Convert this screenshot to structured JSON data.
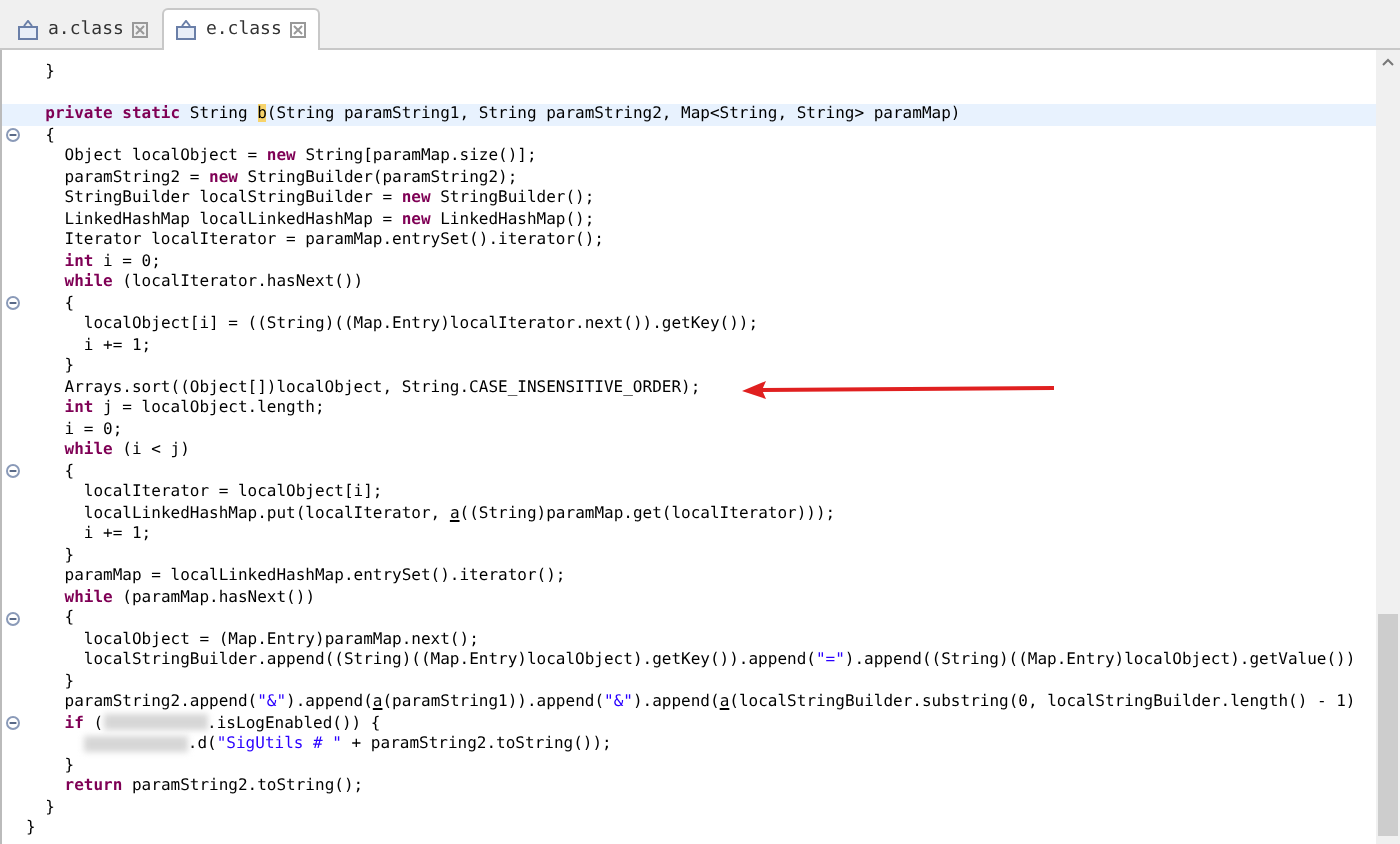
{
  "tabs": [
    {
      "label": "a.class",
      "selected": false
    },
    {
      "label": "e.class",
      "selected": true
    }
  ],
  "code_lines": [
    {
      "kind": "block",
      "children": [
        {
          "kind": "code",
          "fold": false,
          "current": false,
          "arrow": false,
          "tokens": [
            {
              "kind": "plain",
              "text": "}"
            }
          ]
        },
        {
          "kind": "blank",
          "fold": false,
          "current": false,
          "arrow": false
        },
        {
          "kind": "code",
          "fold": false,
          "current": true,
          "arrow": false,
          "tokens": [
            {
              "kind": "keyword",
              "text": "private static"
            },
            {
              "kind": "plain",
              "text": " String "
            },
            {
              "kind": "match",
              "text": "b"
            },
            {
              "kind": "plain",
              "text": "(String paramString1, String paramString2, Map<String, String> paramMap)"
            }
          ]
        },
        {
          "kind": "code",
          "fold": true,
          "current": false,
          "arrow": false,
          "tokens": [
            {
              "kind": "plain",
              "text": "{"
            }
          ]
        },
        {
          "kind": "block",
          "children": [
            {
              "kind": "code",
              "fold": false,
              "current": false,
              "arrow": false,
              "tokens": [
                {
                  "kind": "plain",
                  "text": "Object localObject = "
                },
                {
                  "kind": "keyword",
                  "text": "new"
                },
                {
                  "kind": "plain",
                  "text": " String[paramMap.size()];"
                }
              ]
            },
            {
              "kind": "code",
              "fold": false,
              "current": false,
              "arrow": false,
              "tokens": [
                {
                  "kind": "plain",
                  "text": "paramString2 = "
                },
                {
                  "kind": "keyword",
                  "text": "new"
                },
                {
                  "kind": "plain",
                  "text": " StringBuilder(paramString2);"
                }
              ]
            },
            {
              "kind": "code",
              "fold": false,
              "current": false,
              "arrow": false,
              "tokens": [
                {
                  "kind": "plain",
                  "text": "StringBuilder localStringBuilder = "
                },
                {
                  "kind": "keyword",
                  "text": "new"
                },
                {
                  "kind": "plain",
                  "text": " StringBuilder();"
                }
              ]
            },
            {
              "kind": "code",
              "fold": false,
              "current": false,
              "arrow": false,
              "tokens": [
                {
                  "kind": "plain",
                  "text": "LinkedHashMap localLinkedHashMap = "
                },
                {
                  "kind": "keyword",
                  "text": "new"
                },
                {
                  "kind": "plain",
                  "text": " LinkedHashMap();"
                }
              ]
            },
            {
              "kind": "code",
              "fold": false,
              "current": false,
              "arrow": false,
              "tokens": [
                {
                  "kind": "plain",
                  "text": "Iterator localIterator = paramMap.entrySet().iterator();"
                }
              ]
            },
            {
              "kind": "code",
              "fold": false,
              "current": false,
              "arrow": false,
              "tokens": [
                {
                  "kind": "keyword",
                  "text": "int"
                },
                {
                  "kind": "plain",
                  "text": " i = 0;"
                }
              ]
            },
            {
              "kind": "code",
              "fold": false,
              "current": false,
              "arrow": false,
              "tokens": [
                {
                  "kind": "keyword",
                  "text": "while"
                },
                {
                  "kind": "plain",
                  "text": " (localIterator.hasNext())"
                }
              ]
            },
            {
              "kind": "code",
              "fold": true,
              "current": false,
              "arrow": false,
              "tokens": [
                {
                  "kind": "plain",
                  "text": "{"
                }
              ]
            },
            {
              "kind": "block",
              "children": [
                {
                  "kind": "code",
                  "fold": false,
                  "current": false,
                  "arrow": false,
                  "tokens": [
                    {
                      "kind": "plain",
                      "text": "localObject[i] = ((String)((Map.Entry)localIterator.next()).getKey());"
                    }
                  ]
                },
                {
                  "kind": "code",
                  "fold": false,
                  "current": false,
                  "arrow": false,
                  "tokens": [
                    {
                      "kind": "plain",
                      "text": "i += 1;"
                    }
                  ]
                }
              ]
            },
            {
              "kind": "code",
              "fold": false,
              "current": false,
              "arrow": false,
              "tokens": [
                {
                  "kind": "plain",
                  "text": "}"
                }
              ]
            },
            {
              "kind": "code",
              "fold": false,
              "current": false,
              "arrow": true,
              "tokens": [
                {
                  "kind": "plain",
                  "text": "Arrays.sort((Object[])localObject, String.CASE_INSENSITIVE_ORDER);"
                }
              ]
            },
            {
              "kind": "code",
              "fold": false,
              "current": false,
              "arrow": false,
              "tokens": [
                {
                  "kind": "keyword",
                  "text": "int"
                },
                {
                  "kind": "plain",
                  "text": " j = localObject.length;"
                }
              ]
            },
            {
              "kind": "code",
              "fold": false,
              "current": false,
              "arrow": false,
              "tokens": [
                {
                  "kind": "plain",
                  "text": "i = 0;"
                }
              ]
            },
            {
              "kind": "code",
              "fold": false,
              "current": false,
              "arrow": false,
              "tokens": [
                {
                  "kind": "keyword",
                  "text": "while"
                },
                {
                  "kind": "plain",
                  "text": " (i < j)"
                }
              ]
            },
            {
              "kind": "code",
              "fold": true,
              "current": false,
              "arrow": false,
              "tokens": [
                {
                  "kind": "plain",
                  "text": "{"
                }
              ]
            },
            {
              "kind": "block",
              "children": [
                {
                  "kind": "code",
                  "fold": false,
                  "current": false,
                  "arrow": false,
                  "tokens": [
                    {
                      "kind": "plain",
                      "text": "localIterator = localObject[i];"
                    }
                  ]
                },
                {
                  "kind": "code",
                  "fold": false,
                  "current": false,
                  "arrow": false,
                  "tokens": [
                    {
                      "kind": "plain",
                      "text": "localLinkedHashMap.put(localIterator, "
                    },
                    {
                      "kind": "link",
                      "text": "a"
                    },
                    {
                      "kind": "plain",
                      "text": "((String)paramMap.get(localIterator)));"
                    }
                  ]
                },
                {
                  "kind": "code",
                  "fold": false,
                  "current": false,
                  "arrow": false,
                  "tokens": [
                    {
                      "kind": "plain",
                      "text": "i += 1;"
                    }
                  ]
                }
              ]
            },
            {
              "kind": "code",
              "fold": false,
              "current": false,
              "arrow": false,
              "tokens": [
                {
                  "kind": "plain",
                  "text": "}"
                }
              ]
            },
            {
              "kind": "code",
              "fold": false,
              "current": false,
              "arrow": false,
              "tokens": [
                {
                  "kind": "plain",
                  "text": "paramMap = localLinkedHashMap.entrySet().iterator();"
                }
              ]
            },
            {
              "kind": "code",
              "fold": false,
              "current": false,
              "arrow": false,
              "tokens": [
                {
                  "kind": "keyword",
                  "text": "while"
                },
                {
                  "kind": "plain",
                  "text": " (paramMap.hasNext())"
                }
              ]
            },
            {
              "kind": "code",
              "fold": true,
              "current": false,
              "arrow": false,
              "tokens": [
                {
                  "kind": "plain",
                  "text": "{"
                }
              ]
            },
            {
              "kind": "block",
              "children": [
                {
                  "kind": "code",
                  "fold": false,
                  "current": false,
                  "arrow": false,
                  "tokens": [
                    {
                      "kind": "plain",
                      "text": "localObject = (Map.Entry)paramMap.next();"
                    }
                  ]
                },
                {
                  "kind": "code",
                  "fold": false,
                  "current": false,
                  "arrow": false,
                  "tokens": [
                    {
                      "kind": "plain",
                      "text": "localStringBuilder.append((String)((Map.Entry)localObject).getKey()).append("
                    },
                    {
                      "kind": "string",
                      "text": "\"=\""
                    },
                    {
                      "kind": "plain",
                      "text": ").append((String)((Map.Entry)localObject).getValue())"
                    }
                  ]
                }
              ]
            },
            {
              "kind": "code",
              "fold": false,
              "current": false,
              "arrow": false,
              "tokens": [
                {
                  "kind": "plain",
                  "text": "}"
                }
              ]
            },
            {
              "kind": "code",
              "fold": false,
              "current": false,
              "arrow": false,
              "tokens": [
                {
                  "kind": "plain",
                  "text": "paramString2.append("
                },
                {
                  "kind": "string",
                  "text": "\"&\""
                },
                {
                  "kind": "plain",
                  "text": ").append("
                },
                {
                  "kind": "link",
                  "text": "a"
                },
                {
                  "kind": "plain",
                  "text": "(paramString1)).append("
                },
                {
                  "kind": "string",
                  "text": "\"&\""
                },
                {
                  "kind": "plain",
                  "text": ").append("
                },
                {
                  "kind": "link",
                  "text": "a"
                },
                {
                  "kind": "plain",
                  "text": "(localStringBuilder.substring(0, localStringBuilder.length() - 1)"
                }
              ]
            },
            {
              "kind": "code",
              "fold": true,
              "current": false,
              "arrow": false,
              "tokens": [
                {
                  "kind": "keyword",
                  "text": "if"
                },
                {
                  "kind": "plain",
                  "text": " ("
                },
                {
                  "kind": "redacted"
                },
                {
                  "kind": "plain",
                  "text": ".isLogEnabled()) {"
                }
              ]
            },
            {
              "kind": "block",
              "children": [
                {
                  "kind": "code",
                  "fold": false,
                  "current": false,
                  "arrow": false,
                  "tokens": [
                    {
                      "kind": "redacted"
                    },
                    {
                      "kind": "plain",
                      "text": ".d("
                    },
                    {
                      "kind": "string",
                      "text": "\"SigUtils # \""
                    },
                    {
                      "kind": "plain",
                      "text": " + paramString2.toString());"
                    }
                  ]
                }
              ]
            },
            {
              "kind": "code",
              "fold": false,
              "current": false,
              "arrow": false,
              "tokens": [
                {
                  "kind": "plain",
                  "text": "}"
                }
              ]
            },
            {
              "kind": "code",
              "fold": false,
              "current": false,
              "arrow": false,
              "tokens": [
                {
                  "kind": "keyword",
                  "text": "return"
                },
                {
                  "kind": "plain",
                  "text": " paramString2.toString();"
                }
              ]
            }
          ]
        },
        {
          "kind": "code",
          "fold": false,
          "current": false,
          "arrow": false,
          "tokens": [
            {
              "kind": "plain",
              "text": "}"
            }
          ]
        }
      ]
    },
    {
      "kind": "code",
      "fold": false,
      "current": false,
      "arrow": false,
      "tokens": [
        {
          "kind": "plain",
          "text": "}"
        }
      ]
    }
  ]
}
